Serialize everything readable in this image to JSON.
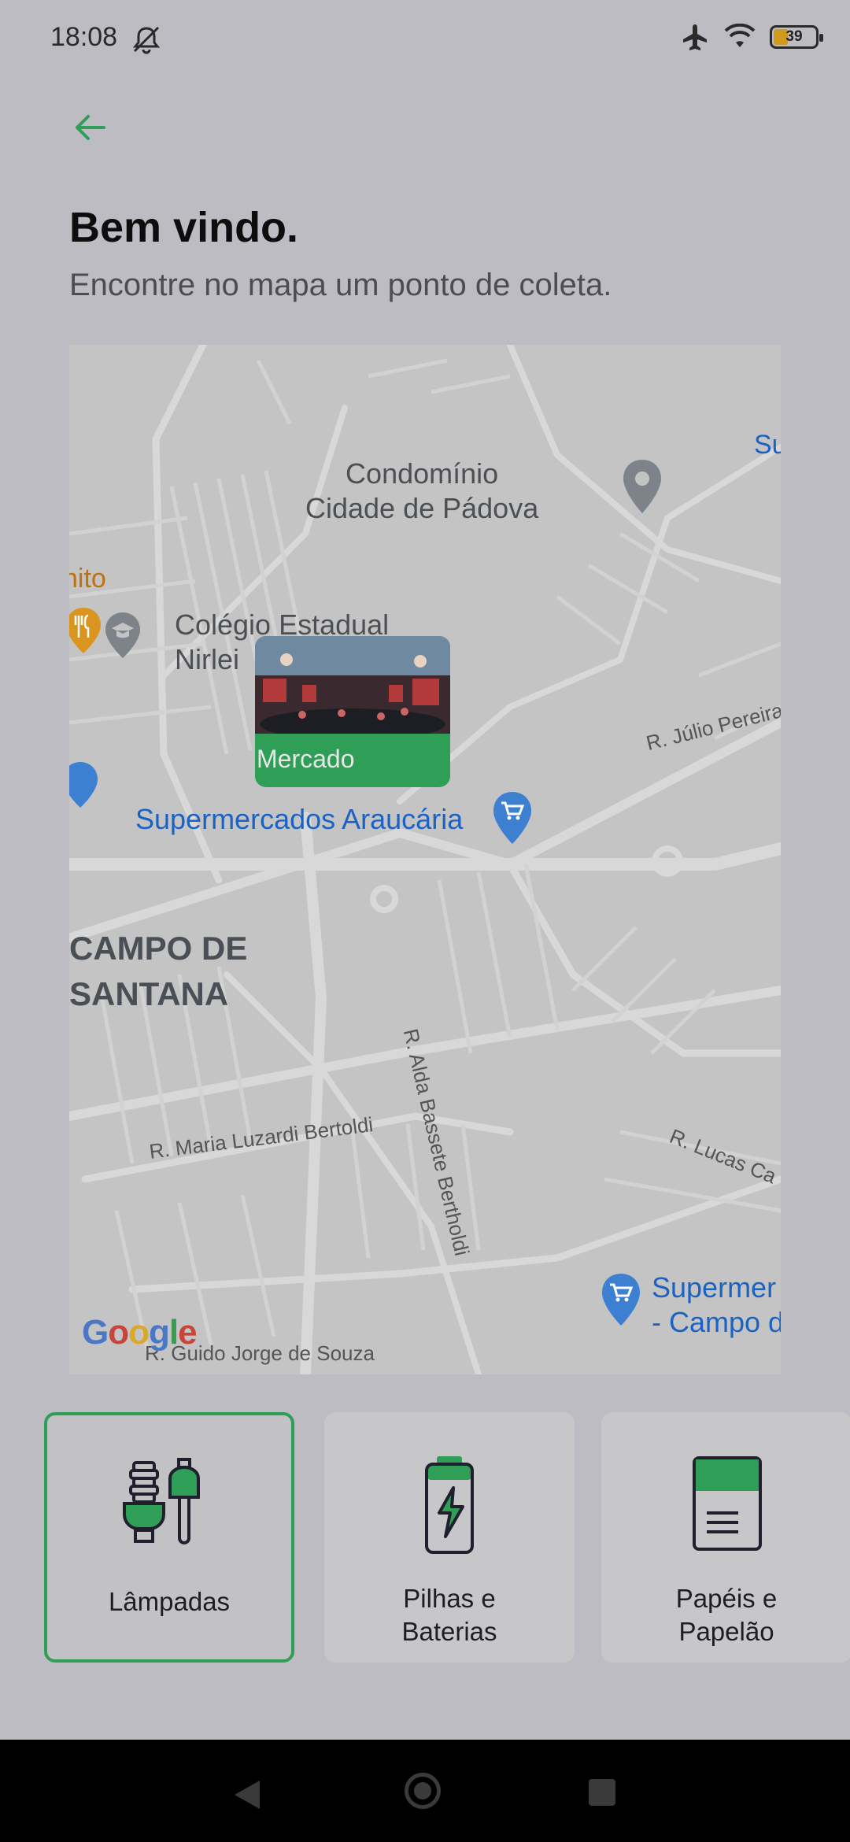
{
  "status_bar": {
    "time": "18:08",
    "battery": "39",
    "icons": [
      "mute-icon",
      "airplane-icon",
      "wifi-icon",
      "battery-icon"
    ]
  },
  "header": {
    "back_icon": "arrow-left-icon",
    "title": "Bem vindo.",
    "subtitle": "Encontre no mapa um ponto de coleta."
  },
  "map": {
    "labels": {
      "condominio_line1": "Condomínio",
      "condominio_line2": "Cidade de Pádova",
      "colegio_line1": "Colégio Estadual",
      "colegio_line2": "Nirlei",
      "supermercados": "Supermercados Araucária",
      "campo_line1": "CAMPO DE",
      "campo_line2": "SANTANA",
      "rua_julio": "R. Júlio Pereira",
      "rua_alda": "R. Alda Bassete Bertholdi",
      "rua_maria": "R. Maria Luzardi Bertoldi",
      "rua_lucas": "R. Lucas Ca",
      "rua_jorge": "R. Guido Jorge de Souza",
      "supermer_line1": "Supermer",
      "supermer_line2": "- Campo d",
      "edge_su": "Su",
      "edge_ito": "nito"
    },
    "marker": {
      "label": "Mercado"
    },
    "attribution": "Google"
  },
  "categories": [
    {
      "label": "Lâmpadas",
      "icon": "lamp-bulb-icon",
      "selected": true
    },
    {
      "label": "Pilhas e\nBaterias",
      "icon": "battery-charge-icon",
      "selected": false
    },
    {
      "label": "Papéis e\nPapelão",
      "icon": "paper-document-icon",
      "selected": false
    }
  ],
  "colors": {
    "accent": "#2f9e57",
    "map_label_blue": "#1a63c4",
    "map_label_orange": "#c1700f"
  }
}
